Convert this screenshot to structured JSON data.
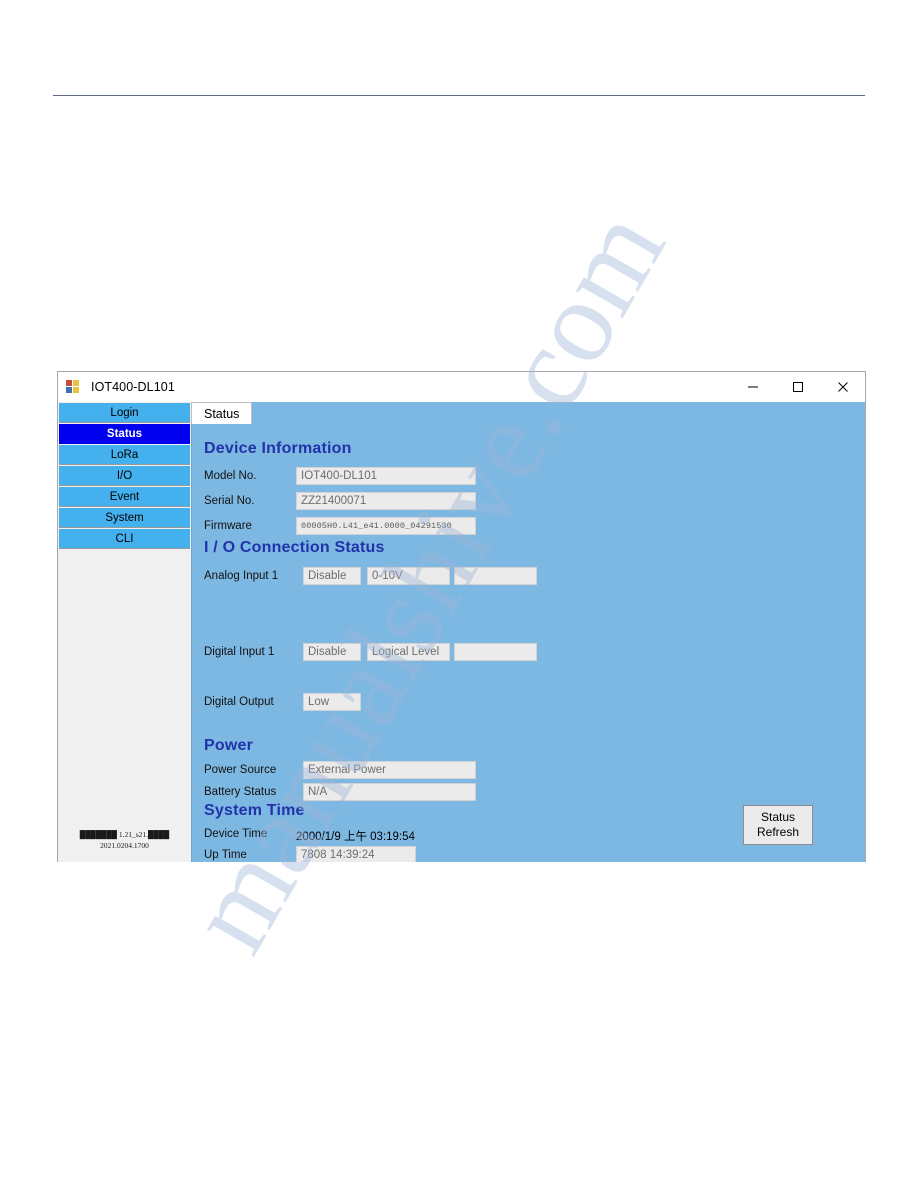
{
  "window": {
    "title": "IOT400-DL101",
    "icon": "app-window-icon",
    "controls": {
      "minimize": "minimize-icon",
      "maximize": "maximize-icon",
      "close": "close-icon"
    }
  },
  "sidebar": {
    "items": [
      {
        "label": "Login",
        "active": false
      },
      {
        "label": "Status",
        "active": true
      },
      {
        "label": "LoRa",
        "active": false
      },
      {
        "label": "I/O",
        "active": false
      },
      {
        "label": "Event",
        "active": false
      },
      {
        "label": "System",
        "active": false
      },
      {
        "label": "CLI",
        "active": false
      }
    ],
    "footer": {
      "line1": "███████ 1.21_s21.████",
      "line2": "2021.0204.1700"
    }
  },
  "tabs": [
    {
      "label": "Status",
      "active": true
    }
  ],
  "panel": {
    "device_information": {
      "heading": "Device Information",
      "rows": [
        {
          "label": "Model No.",
          "value": "IOT400-DL101"
        },
        {
          "label": "Serial No.",
          "value": "ZZ21400071"
        },
        {
          "label": "Firmware",
          "value": "00005H0.L41_e41.0000_04291530"
        }
      ]
    },
    "io_connection_status": {
      "heading": "I / O Connection Status",
      "rows": [
        {
          "label": "Analog Input 1",
          "state": "Disable",
          "mode": "0-10V",
          "reading": ""
        },
        {
          "label": "Digital Input 1",
          "state": "Disable",
          "mode": "Logical Level",
          "reading": ""
        },
        {
          "label": "Digital Output",
          "state": "Low"
        }
      ]
    },
    "power": {
      "heading": "Power",
      "rows": [
        {
          "label": "Power Source",
          "value": "External Power"
        },
        {
          "label": "Battery Status",
          "value": "N/A"
        }
      ]
    },
    "system_time": {
      "heading": "System Time",
      "device_time_label": "Device Time",
      "device_time_value": "2000/1/9 上午 03:19:54",
      "up_time_label": "Up Time",
      "up_time_value": "7808 14:39:24"
    },
    "refresh_button": {
      "line1": "Status",
      "line2": "Refresh"
    }
  },
  "watermark": {
    "text": "manualshive.com"
  },
  "colors": {
    "panel_background": "#7db8e3",
    "nav_button": "#45b0ee",
    "nav_button_active": "#0000ee",
    "heading": "#2233aa",
    "field_background": "#ebebeb"
  }
}
